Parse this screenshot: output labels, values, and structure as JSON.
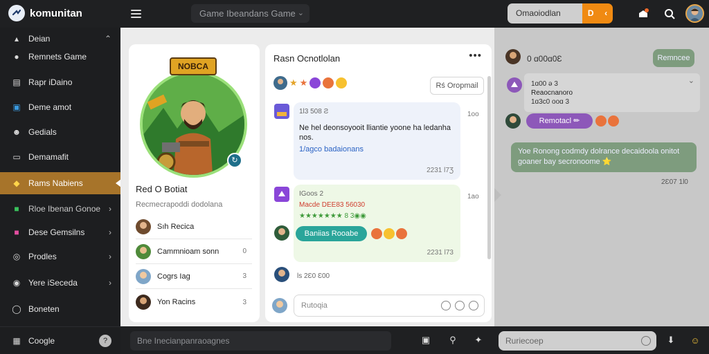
{
  "app": {
    "name": "komunitan"
  },
  "topbar": {
    "game_select": "Game Ibeandans Game",
    "pill_label": "Omaoiodlan",
    "pill_action": "D"
  },
  "sidebar": {
    "items": [
      {
        "label": "Deian"
      },
      {
        "label": "Remnets Game"
      },
      {
        "label": "Rapr iDaino"
      },
      {
        "label": "Deme amot"
      },
      {
        "label": "Gedials"
      },
      {
        "label": "Demamafit"
      },
      {
        "label": "Rams Nabiens"
      },
      {
        "label": "Rloe Ibenan Gonoe"
      },
      {
        "label": "Dese Gemsilns"
      },
      {
        "label": "Prodles"
      },
      {
        "label": "Yere iSeceda"
      },
      {
        "label": "Boneten"
      },
      {
        "label": "Coogle"
      }
    ]
  },
  "profile": {
    "banner": "NOBCA",
    "name": "Red O Botiat",
    "subtitle": "Recmecrapoddi dodolana",
    "members": [
      {
        "name": "Sıh Recica",
        "count": ""
      },
      {
        "name": "Cammnioam sonn",
        "count": "0"
      },
      {
        "name": "Cogrs Iag",
        "count": "3"
      },
      {
        "name": "Yon Racins",
        "count": "3"
      }
    ]
  },
  "chat": {
    "title": "Rasn Ocnotlolan",
    "menu": "•••",
    "send_button": "Rś Oropmail",
    "messages": [
      {
        "header": "1Ɩ3 508 Ƨ",
        "side_time": "1oo",
        "text": "Ne hel deonsoyooit lliantie yoone ha ledanha nos.",
        "link": "1/agco badaionans",
        "foot": "2231 Ɩ7Ʒ"
      },
      {
        "header": "IGoos 2",
        "side_time": "1ao",
        "red": "Macde DEE83 56030",
        "stars": "★★★★★★★ 8 3◉◉",
        "button": "Baniias Rooabe",
        "foot": "2231 Ɩ73"
      }
    ],
    "tiny_time": "ls 2Ɛ0 Ɛ00",
    "input_placeholder": "Rutoqia"
  },
  "right_panel": {
    "name": "0 ɑ00ɑ0Ɛ",
    "pill": "Remncee",
    "card_line1": "1ɑ00 ə 3",
    "card_line2": "Reaocnanoro",
    "card_line3": "1ɑ3c0 ooɑ 3",
    "purple_pill": "Remotacl ✏",
    "green_text": "Yoe Ronong codmdy dolrance decaidoola onitot goaner bay secronoome ⭐",
    "time": "2Ɛ07 1Ɩ0"
  },
  "bottombar": {
    "search_placeholder": "Bne Inecianpanraoagnes",
    "input_placeholder": "Ruriecoep"
  }
}
